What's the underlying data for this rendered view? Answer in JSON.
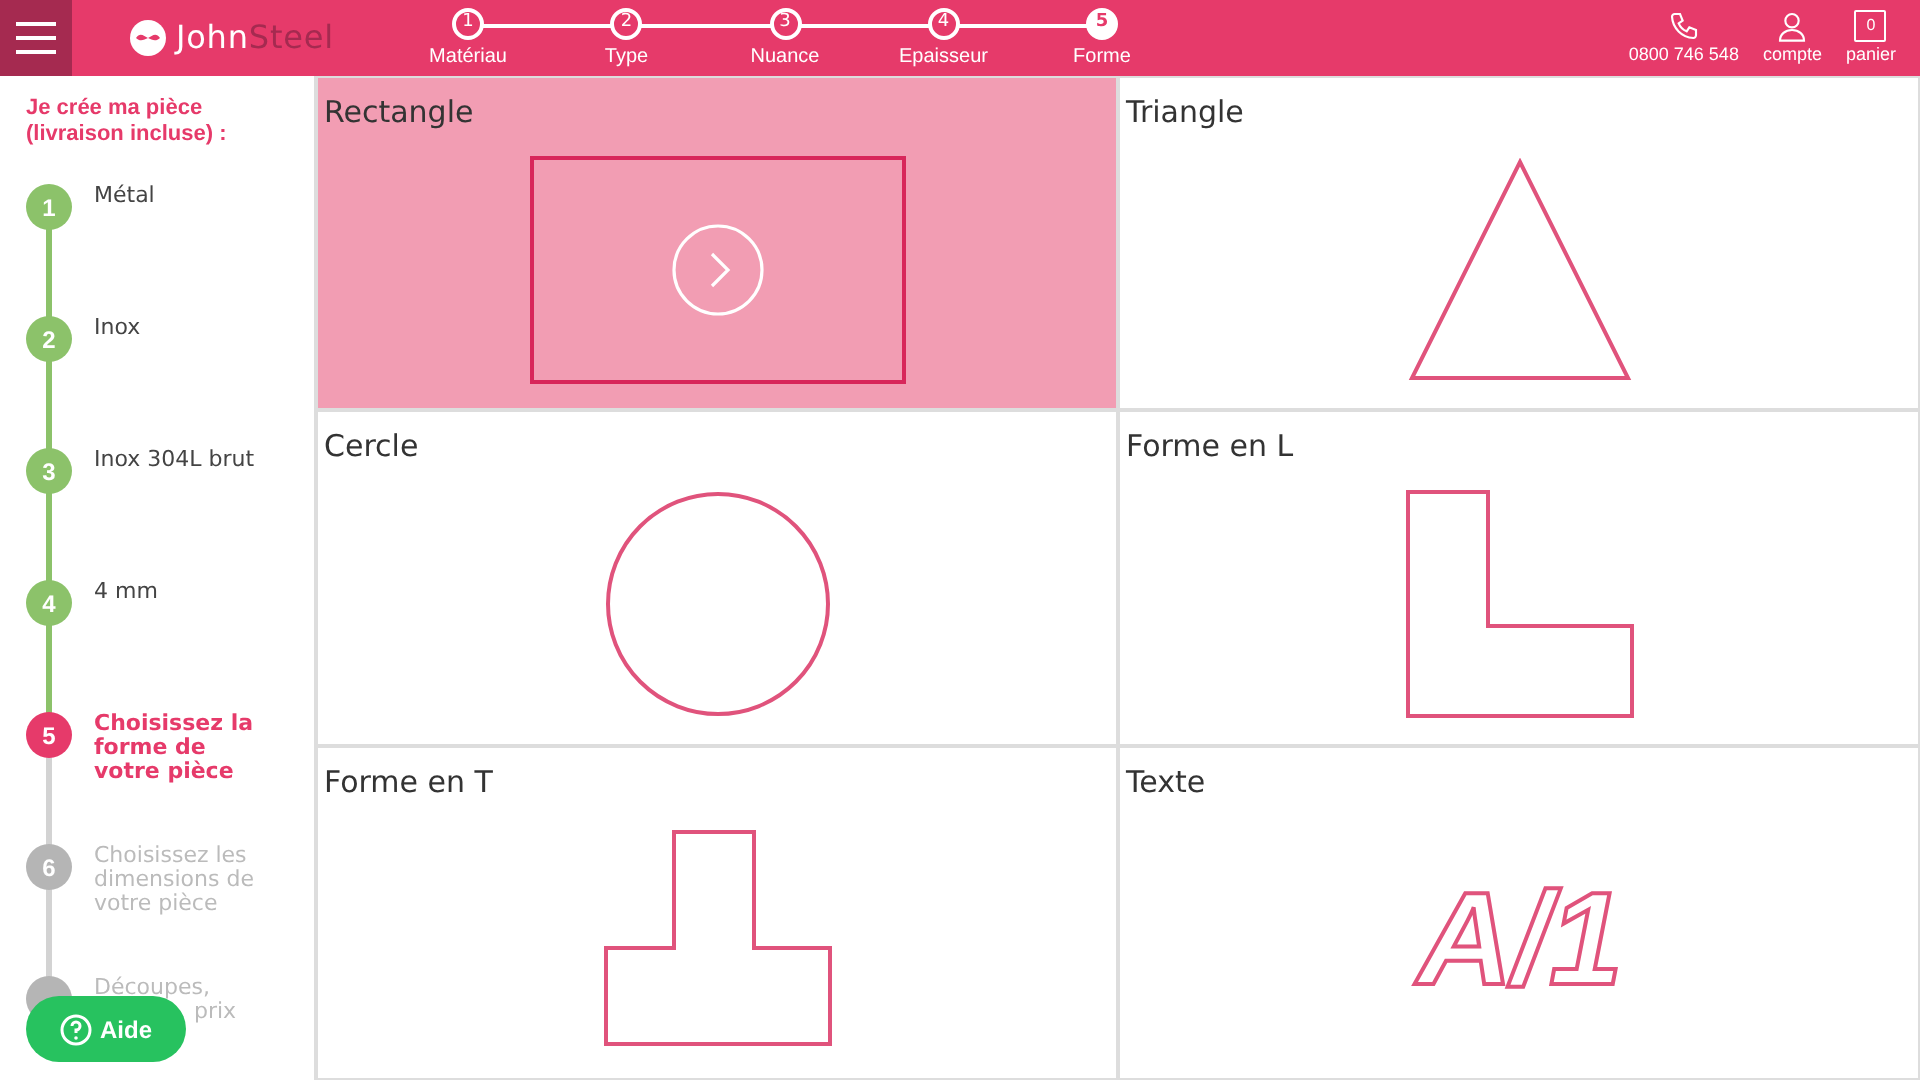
{
  "header": {
    "brand_first": "John",
    "brand_second": "Steel",
    "steps": [
      {
        "number": "1",
        "label": "Matériau",
        "selected": false
      },
      {
        "number": "2",
        "label": "Type",
        "selected": false
      },
      {
        "number": "3",
        "label": "Nuance",
        "selected": false
      },
      {
        "number": "4",
        "label": "Epaisseur",
        "selected": false
      },
      {
        "number": "5",
        "label": "Forme",
        "selected": true
      }
    ],
    "phone": "0800 746 548",
    "account": "compte",
    "cart": "panier",
    "cart_count": "0"
  },
  "sidebar": {
    "title": "Je crée ma pièce (livraison incluse) :",
    "steps": [
      {
        "number": "1",
        "label": "Métal",
        "completed": true,
        "selected": false
      },
      {
        "number": "2",
        "label": "Inox",
        "completed": true,
        "selected": false
      },
      {
        "number": "3",
        "label": "Inox 304L brut",
        "completed": true,
        "selected": false
      },
      {
        "number": "4",
        "label": "4 mm",
        "completed": true,
        "selected": false
      },
      {
        "number": "5",
        "label": "Choisissez la forme de votre pièce",
        "completed": false,
        "selected": true
      },
      {
        "number": "6",
        "label": "Choisissez les dimensions de votre pièce",
        "completed": false,
        "selected": false
      },
      {
        "label": "Découpes,",
        "label_tail": "prix",
        "completed": false,
        "selected": false
      }
    ],
    "help_button": "Aide"
  },
  "shapes": [
    {
      "name": "Rectangle",
      "kind": "rectangle",
      "selected": true
    },
    {
      "name": "Triangle",
      "kind": "triangle",
      "selected": false
    },
    {
      "name": "Cercle",
      "kind": "circle",
      "selected": false
    },
    {
      "name": "Forme en L",
      "kind": "l-shape",
      "selected": false
    },
    {
      "name": "Forme en T",
      "kind": "t-shape",
      "selected": false
    },
    {
      "name": "Texte",
      "kind": "text",
      "sample": "A/1",
      "selected": false
    }
  ]
}
